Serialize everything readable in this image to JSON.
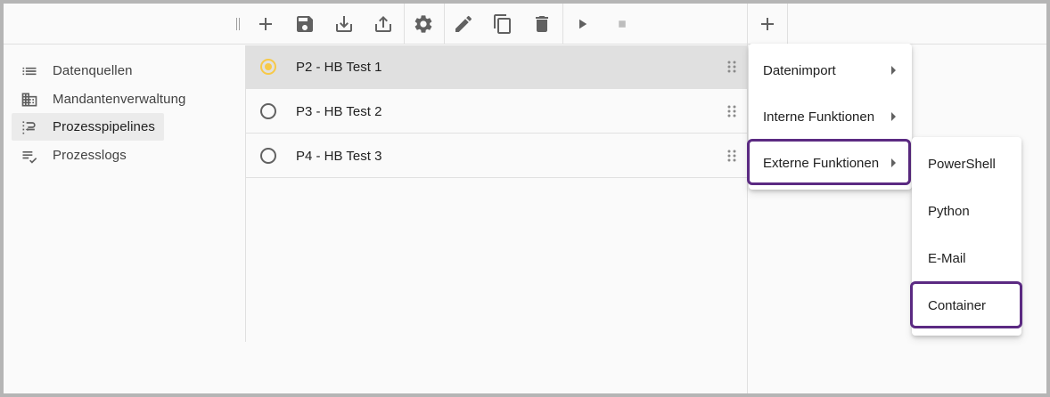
{
  "toolbar": {
    "buttons": [
      {
        "name": "add-icon",
        "label": "add"
      },
      {
        "name": "save-icon",
        "label": "save"
      },
      {
        "name": "import-icon",
        "label": "import"
      },
      {
        "name": "export-icon",
        "label": "export"
      },
      {
        "name": "settings-icon",
        "label": "settings"
      },
      {
        "name": "edit-icon",
        "label": "edit"
      },
      {
        "name": "copy-icon",
        "label": "copy"
      },
      {
        "name": "delete-icon",
        "label": "delete"
      },
      {
        "name": "play-icon",
        "label": "run"
      },
      {
        "name": "stop-icon",
        "label": "stop"
      },
      {
        "name": "add-step-icon",
        "label": "add step"
      }
    ]
  },
  "sidebar": {
    "items": [
      {
        "label": "Datenquellen",
        "icon": "list-icon",
        "active": false
      },
      {
        "label": "Mandantenverwaltung",
        "icon": "building-icon",
        "active": false
      },
      {
        "label": "Prozesspipelines",
        "icon": "pipeline-icon",
        "active": true
      },
      {
        "label": "Prozesslogs",
        "icon": "log-check-icon",
        "active": false
      }
    ]
  },
  "pipelines": {
    "rows": [
      {
        "label": "P2 - HB Test 1",
        "selected": true
      },
      {
        "label": "P3 - HB Test 2",
        "selected": false
      },
      {
        "label": "P4 - HB Test 3",
        "selected": false
      }
    ]
  },
  "menu": {
    "items": [
      {
        "label": "Datenimport"
      },
      {
        "label": "Interne Funktionen"
      },
      {
        "label": "Externe Funktionen"
      }
    ]
  },
  "submenu": {
    "items": [
      {
        "label": "PowerShell"
      },
      {
        "label": "Python"
      },
      {
        "label": "E-Mail"
      },
      {
        "label": "Container"
      }
    ]
  },
  "colors": {
    "highlight": "#5b2a82",
    "radio_checked": "#f7c948",
    "selected_row": "#e0e0e0"
  }
}
